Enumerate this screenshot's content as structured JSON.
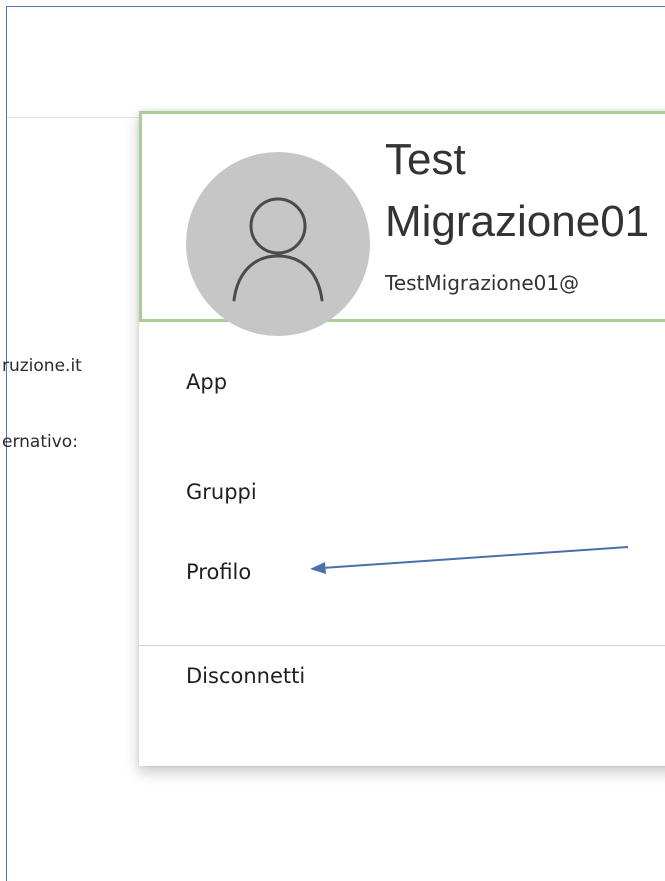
{
  "background": {
    "text_1": "ruzione.it",
    "text_2": "ernativo:"
  },
  "account": {
    "name_first": "Test",
    "name_last": "Migrazione01",
    "email": "TestMigrazione01@"
  },
  "menu": {
    "items": [
      {
        "label": "App"
      },
      {
        "label": "Gruppi"
      },
      {
        "label": "Profilo"
      }
    ],
    "signout_label": "Disconnetti"
  },
  "colors": {
    "frame_border": "#4a78b8",
    "header_border": "#a9cf94",
    "avatar_bg": "#c6c6c6",
    "annotation_arrow": "#4a6fae"
  },
  "icons": {
    "avatar": "person-outline-icon",
    "annotation": "arrow-left-icon"
  }
}
